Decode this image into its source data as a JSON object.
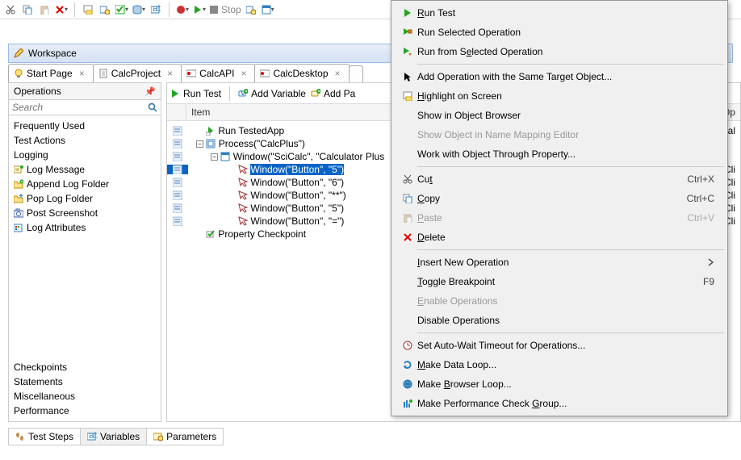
{
  "toplabel": {
    "stop": "Stop"
  },
  "workspace": {
    "title": "Workspace"
  },
  "tabs": [
    {
      "label": "Start Page"
    },
    {
      "label": "CalcProject"
    },
    {
      "label": "CalcAPI"
    },
    {
      "label": "CalcDesktop"
    }
  ],
  "panel": {
    "title": "Operations",
    "search_placeholder": "Search",
    "groups": [
      "Frequently Used",
      "Test Actions",
      "Logging"
    ],
    "items": [
      "Log Message",
      "Append Log Folder",
      "Pop Log Folder",
      "Post Screenshot",
      "Log Attributes"
    ],
    "items2": [
      "Checkpoints",
      "Statements",
      "Miscellaneous",
      "Performance"
    ]
  },
  "test_toolbar": {
    "run": "Run Test",
    "addvar": "Add Variable",
    "addpa": "Add Pa"
  },
  "cols": {
    "item": "Item",
    "op": "Op",
    "cal": "Cal"
  },
  "tree": {
    "r0": "Run TestedApp",
    "r1": "Process(\"CalcPlus\")",
    "r2": "Window(\"SciCalc\", \"Calculator Plus",
    "r3": "Window(\"Button\", \"5\")",
    "r4": "Window(\"Button\", \"6\")",
    "r5": "Window(\"Button\", \"**\")",
    "r6": "Window(\"Button\", \"5\")",
    "r7": "Window(\"Button\", \"=\")",
    "r8": "Property Checkpoint",
    "op": "Cli"
  },
  "btabs": {
    "steps": "Test Steps",
    "vars": "Variables",
    "params": "Parameters"
  },
  "ctx": {
    "run_test": "Run Test",
    "run_sel": "Run Selected Operation",
    "run_from": "Run from Selected Operation",
    "add_op": "Add Operation with the Same Target Object...",
    "highlight": "Highlight on Screen",
    "show_browser": "Show in Object Browser",
    "show_mapping": "Show Object in Name Mapping Editor",
    "work_prop": "Work with Object Through Property...",
    "cut": "Cut",
    "copy": "Copy",
    "paste": "Paste",
    "delete": "Delete",
    "cut_sc": "Ctrl+X",
    "copy_sc": "Ctrl+C",
    "paste_sc": "Ctrl+V",
    "insert": "Insert New Operation",
    "toggle_bp": "Toggle Breakpoint",
    "toggle_sc": "F9",
    "enable": "Enable Operations",
    "disable": "Disable Operations",
    "autowait": "Set Auto-Wait Timeout for Operations...",
    "dataloop": "Make Data Loop...",
    "browserloop": "Make Browser Loop...",
    "perfgroup": "Make Performance Check Group..."
  }
}
